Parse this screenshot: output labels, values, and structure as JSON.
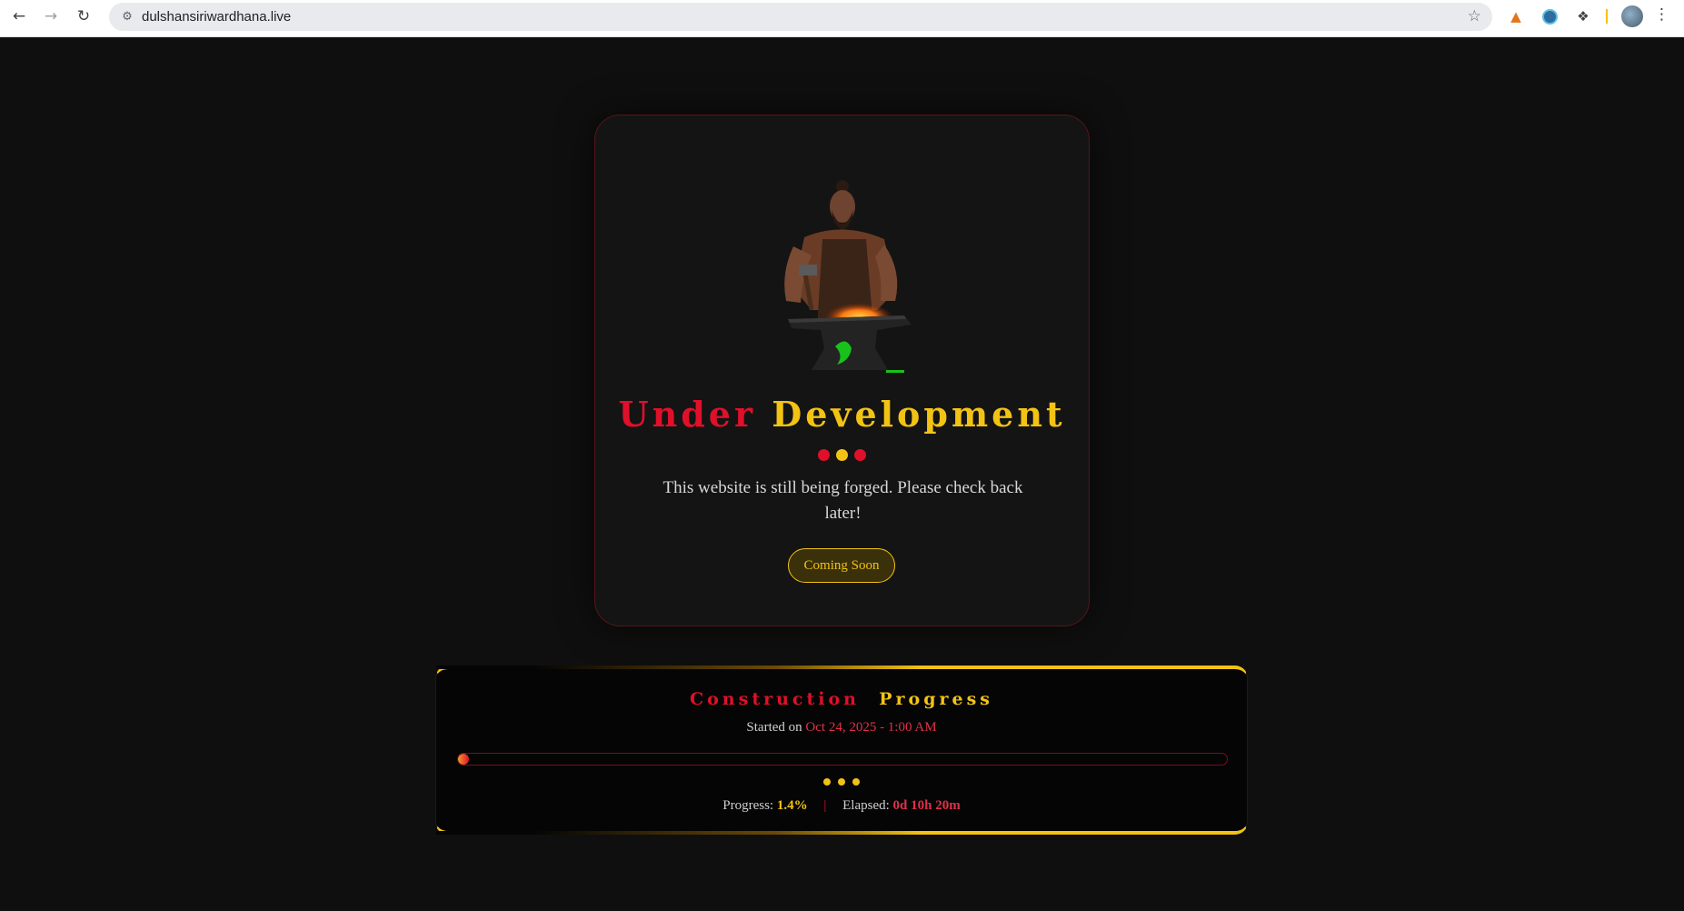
{
  "browser": {
    "url": "dulshansiriwardhana.live"
  },
  "hero": {
    "title_word1": "Under",
    "title_word2": "Development",
    "message": "This website is still being forged. Please check back later!",
    "button_label": "Coming Soon"
  },
  "progress": {
    "title_word1": "Construction",
    "title_word2": "Progress",
    "started_label": "Started on",
    "started_date": "Oct 24, 2025 - 1:00 AM",
    "progress_label": "Progress:",
    "progress_value": "1.4%",
    "progress_fraction": 0.014,
    "elapsed_label": "Elapsed:",
    "elapsed_value": "0d 10h 20m"
  },
  "colors": {
    "accent_red": "#e0102a",
    "accent_gold": "#f2c314",
    "background": "#0f0f0f"
  }
}
